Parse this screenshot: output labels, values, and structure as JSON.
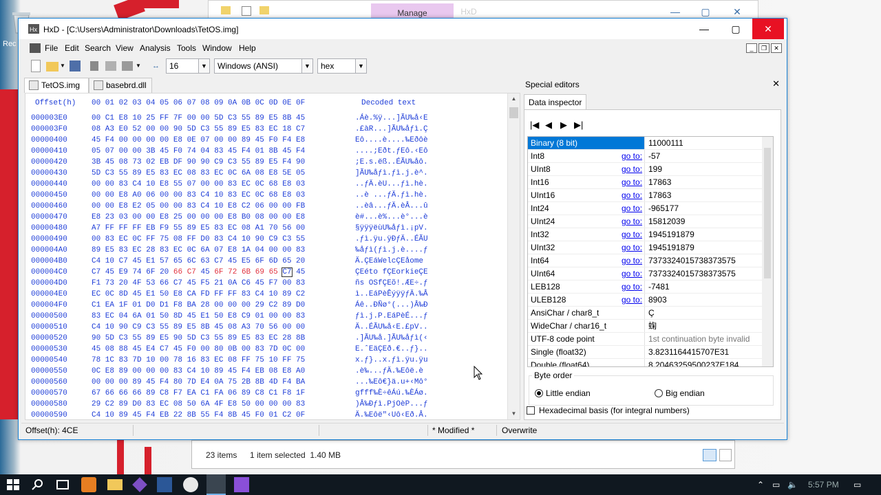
{
  "desktop": {
    "icon_label": "Rec"
  },
  "explorer": {
    "ribbon_tab": "Manage",
    "ghost_label": "HxD",
    "items_count": "23 items",
    "selection": "1 item selected  1.40 MB"
  },
  "window": {
    "title": "HxD - [C:\\Users\\Administrator\\Downloads\\TetOS.img]"
  },
  "menu": [
    "File",
    "Edit",
    "Search",
    "View",
    "Analysis",
    "Tools",
    "Window",
    "Help"
  ],
  "toolbar": {
    "bytes_per_row": "16",
    "charset": "Windows (ANSI)",
    "offset_base": "hex"
  },
  "tabs": [
    "TetOS.img",
    "basebrd.dll"
  ],
  "hex": {
    "header_offset": "Offset(h)",
    "header_cols": "00 01 02 03 04 05 06 07 08 09 0A 0B 0C 0D 0E 0F",
    "header_text": "Decoded text",
    "rows": [
      {
        "off": "000003E0",
        "hex": "00 C1 E8 10 25 FF 7F 00 00 5D C3 55 89 E5 8B 45",
        "txt": ".Áè.%ÿ...]ÃU‰å‹E"
      },
      {
        "off": "000003F0",
        "hex": "08 A3 E0 52 00 00 90 5D C3 55 89 E5 83 EC 18 C7",
        "txt": ".£àR...]ÃU‰åƒì.Ç"
      },
      {
        "off": "00000400",
        "hex": "45 F4 00 00 00 00 E8 0E 07 00 00 89 45 F0 F4 E8",
        "txt": "Eô....è....‰Eðôè"
      },
      {
        "off": "00000410",
        "hex": "05 07 00 00 3B 45 F0 74 04 83 45 F4 01 8B 45 F4",
        "txt": "....;Eðt.ƒEô.‹Eô"
      },
      {
        "off": "00000420",
        "hex": "3B 45 08 73 02 EB DF 90 90 C9 C3 55 89 E5 F4 90",
        "txt": ";E.s.ëß..ÉÃU‰åô."
      },
      {
        "off": "00000430",
        "hex": "5D C3 55 89 E5 83 EC 08 83 EC 0C 6A 08 E8 5E 05",
        "txt": "]ÃU‰åƒì.ƒì.j.è^."
      },
      {
        "off": "00000440",
        "hex": "00 00 83 C4 10 E8 55 07 00 00 83 EC 0C 68 E8 03",
        "txt": "..ƒÄ.èU...ƒì.hè."
      },
      {
        "off": "00000450",
        "hex": "00 00 E8 A0 06 00 00 83 C4 10 83 EC 0C 68 E8 03",
        "txt": "..è ...ƒÄ.ƒì.hè."
      },
      {
        "off": "00000460",
        "hex": "00 00 E8 E2 05 00 00 83 C4 10 E8 C2 06 00 00 FB",
        "txt": "..èâ...ƒÄ.èÂ...û"
      },
      {
        "off": "00000470",
        "hex": "E8 23 03 00 00 E8 25 00 00 00 E8 B0 08 00 00 E8",
        "txt": "è#...è%...è°...è"
      },
      {
        "off": "00000480",
        "hex": "A7 FF FF FF EB F9 55 89 E5 83 EC 08 A1 70 56 00",
        "txt": "§ÿÿÿëùU‰åƒì.¡pV."
      },
      {
        "off": "00000490",
        "hex": "00 83 EC 0C FF 75 08 FF D0 83 C4 10 90 C9 C3 55",
        "txt": ".ƒì.ÿu.ÿÐƒÄ..ÉÃU"
      },
      {
        "off": "000004A0",
        "hex": "89 E5 83 EC 28 83 EC 0C 6A 07 E8 1A 04 00 00 83",
        "txt": "‰åƒì(ƒì.j.è....ƒ"
      },
      {
        "off": "000004B0",
        "hex": "C4 10 C7 45 E1 57 65 6C 63 C7 45 E5 6F 6D 65 20",
        "txt": "Ä.ÇEáWelcÇEåome "
      },
      {
        "off": "000004C0",
        "hex": "C7 45 E9 74 6F 20 66 C7 45 6F 72 6B 69 65 C7 45",
        "txt": "ÇEéto fÇEorkieÇE"
      },
      {
        "off": "000004D0",
        "hex": "F1 73 20 4F 53 66 C7 45 F5 21 0A C6 45 F7 00 83",
        "txt": "ñs OSfÇEõ!.ÆE÷.ƒ"
      },
      {
        "off": "000004E0",
        "hex": "EC 0C 8D 45 E1 50 E8 CA FD FF FF 83 C4 10 89 C2",
        "txt": "ì..EáPèÊýÿÿƒÄ.‰Â"
      },
      {
        "off": "000004F0",
        "hex": "C1 EA 1F 01 D0 D1 F8 BA 28 00 00 00 29 C2 89 D0",
        "txt": "Áê..ÐÑø°(...)Â‰Ð"
      },
      {
        "off": "00000500",
        "hex": "83 EC 04 6A 01 50 8D 45 E1 50 E8 C9 01 00 00 83",
        "txt": "ƒì.j.P.EáPèÉ...ƒ"
      },
      {
        "off": "00000510",
        "hex": "C4 10 90 C9 C3 55 89 E5 8B 45 08 A3 70 56 00 00",
        "txt": "Ä..ÉÃU‰å‹E.£pV.."
      },
      {
        "off": "00000520",
        "hex": "90 5D C3 55 89 E5 90 5D C3 55 89 E5 83 EC 28 8B",
        "txt": ".]ÃU‰å.]ÃU‰åƒì(‹"
      },
      {
        "off": "00000530",
        "hex": "45 08 88 45 E4 C7 45 F0 00 80 0B 00 83 7D 0C 00",
        "txt": "E.ˆEäÇEð.€..ƒ}.."
      },
      {
        "off": "00000540",
        "hex": "78 1C 83 7D 10 00 78 16 83 EC 08 FF 75 10 FF 75",
        "txt": "x.ƒ}..x.ƒì.ÿu.ÿu"
      },
      {
        "off": "00000550",
        "hex": "0C E8 89 00 00 00 83 C4 10 89 45 F4 EB 08 E8 A0",
        "txt": ".è‰...ƒÄ.‰Eôë.è "
      },
      {
        "off": "00000560",
        "hex": "00 00 00 89 45 F4 80 7D E4 0A 75 2B 8B 4D F4 BA",
        "txt": "...‰Eô€}ä.u+‹Mô°"
      },
      {
        "off": "00000570",
        "hex": "67 66 66 66 89 C8 F7 EA C1 FA 06 89 C8 C1 F8 1F",
        "txt": "gfff‰È÷êÁú.‰ÈÁø."
      },
      {
        "off": "00000580",
        "hex": "29 C2 89 D0 83 EC 08 50 6A 4F E8 50 00 00 00 83",
        "txt": ")Â‰Ðƒì.PjOèP...ƒ"
      },
      {
        "off": "00000590",
        "hex": "C4 10 89 45 F4 EB 22 8B 55 F4 8B 45 F0 01 C2 0F",
        "txt": "Ä.‰Eôë\"‹Uô‹Eð.Â."
      }
    ]
  },
  "special_editors": {
    "title": "Special editors",
    "tab": "Data inspector",
    "goto_label": "go to:",
    "rows": [
      {
        "name": "Binary (8 bit)",
        "value": "11000111",
        "goto": false,
        "selected": true
      },
      {
        "name": "Int8",
        "value": "-57",
        "goto": true
      },
      {
        "name": "UInt8",
        "value": "199",
        "goto": true
      },
      {
        "name": "Int16",
        "value": "17863",
        "goto": true
      },
      {
        "name": "UInt16",
        "value": "17863",
        "goto": true
      },
      {
        "name": "Int24",
        "value": "-965177",
        "goto": true
      },
      {
        "name": "UInt24",
        "value": "15812039",
        "goto": true
      },
      {
        "name": "Int32",
        "value": "1945191879",
        "goto": true
      },
      {
        "name": "UInt32",
        "value": "1945191879",
        "goto": true
      },
      {
        "name": "Int64",
        "value": "7373324015738373575",
        "goto": true
      },
      {
        "name": "UInt64",
        "value": "7373324015738373575",
        "goto": true
      },
      {
        "name": "LEB128",
        "value": "-7481",
        "goto": true
      },
      {
        "name": "ULEB128",
        "value": "8903",
        "goto": true
      },
      {
        "name": "AnsiChar / char8_t",
        "value": "Ç",
        "goto": false
      },
      {
        "name": "WideChar / char16_t",
        "value": "䗇",
        "goto": false
      },
      {
        "name": "UTF-8 code point",
        "value": "1st continuation byte invalid",
        "goto": false,
        "grey": true
      },
      {
        "name": "Single (float32)",
        "value": "3.8231164415707E31",
        "goto": false
      },
      {
        "name": "Double (float64)",
        "value": "8.20463259500237E184",
        "goto": false
      }
    ],
    "byte_order_label": "Byte order",
    "little_endian": "Little endian",
    "big_endian": "Big endian",
    "hex_basis": "Hexadecimal basis (for integral numbers)"
  },
  "status": {
    "offset": "Offset(h): 4CE",
    "modified": "* Modified *",
    "mode": "Overwrite"
  },
  "taskbar": {
    "clock": "5:57 PM"
  },
  "colors": {
    "accent": "#0078d7",
    "hex_text": "#1f3ed8",
    "highlight": "#e0303c",
    "close": "#e81123"
  }
}
